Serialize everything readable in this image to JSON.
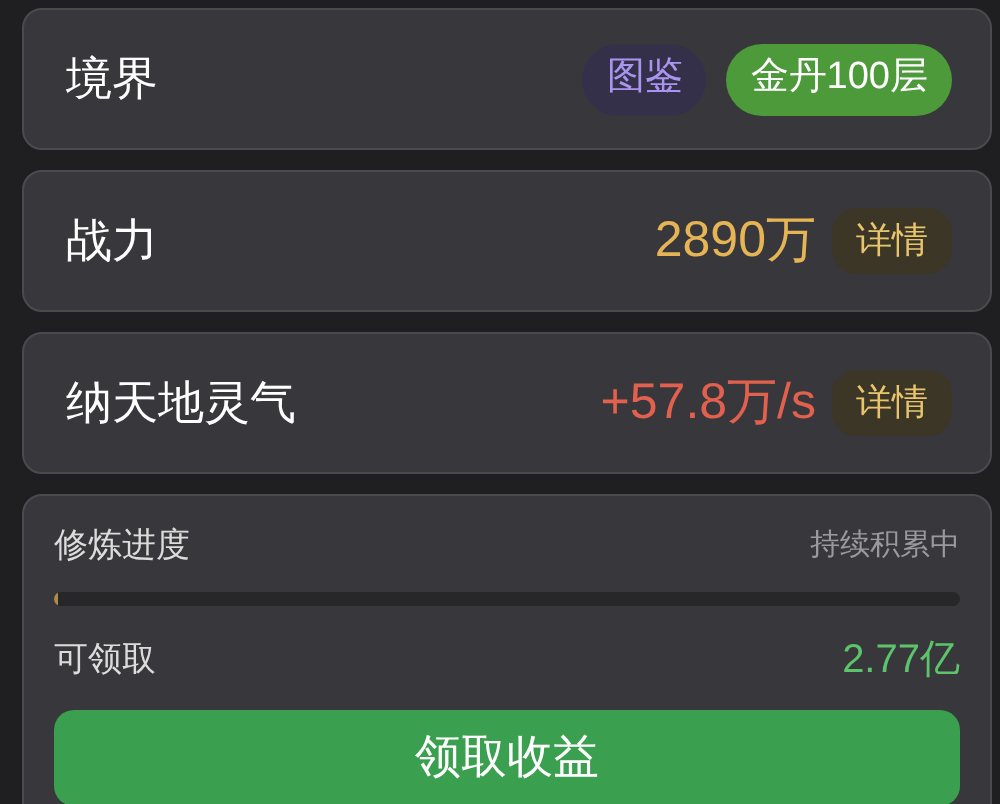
{
  "rows": [
    {
      "kind": "badges",
      "label": "境界",
      "badges": [
        {
          "text": "图鉴",
          "kind": "purple"
        },
        {
          "text": "金丹100层",
          "kind": "green"
        }
      ]
    },
    {
      "kind": "stat",
      "label": "战力",
      "value": "2890万",
      "color": "#e5b454",
      "button": "详情"
    },
    {
      "kind": "stat",
      "label": "纳天地灵气",
      "value": "+57.8万/s",
      "color": "#e2604e",
      "button": "详情"
    }
  ],
  "progress": {
    "title": "修炼进度",
    "status": "持续积累中",
    "level": 0.005,
    "claim_label": "可领取",
    "claim_value": "2.77亿",
    "button": "领取收益"
  }
}
